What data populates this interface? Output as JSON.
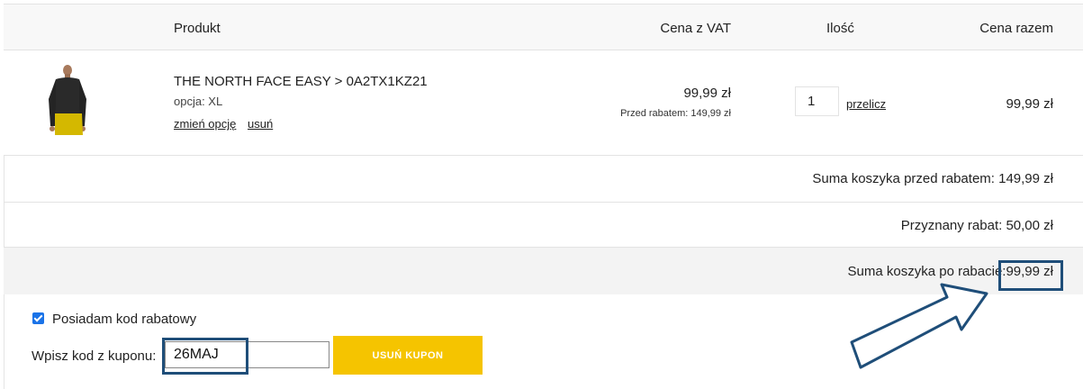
{
  "table_header": {
    "product": "Produkt",
    "price": "Cena z VAT",
    "quantity": "Ilość",
    "total": "Cena razem"
  },
  "item": {
    "name": "THE NORTH FACE EASY > 0A2TX1KZ21",
    "option": "opcja: XL",
    "change_option_link": "zmień opcję",
    "remove_link": "usuń",
    "price": "99,99 zł",
    "price_before": "Przed rabatem: 149,99 zł",
    "quantity": "1",
    "recalc_link": "przelicz",
    "total": "99,99 zł",
    "image": "black-longsleeve-shirt-model-photo"
  },
  "summary": {
    "before_discount": "Suma koszyka przed rabatem: 149,99 zł",
    "discount": "Przyznany rabat: 50,00 zł",
    "after_discount_label": "Suma koszyka po rabacie:",
    "after_discount_value": "99,99 zł"
  },
  "coupon": {
    "checkbox_label": "Posiadam kod rabatowy",
    "checked": true,
    "input_label": "Wpisz kod z kuponu:",
    "code_value": "26MAJ",
    "remove_button": "USUŃ KUPON"
  },
  "annotation": {
    "color": "#1f4e79",
    "arrow": "arrow-icon"
  },
  "colors": {
    "button_bg": "#f5c400",
    "header_bg": "#f8f8f8",
    "highlight_row_bg": "#f3f3f3"
  }
}
